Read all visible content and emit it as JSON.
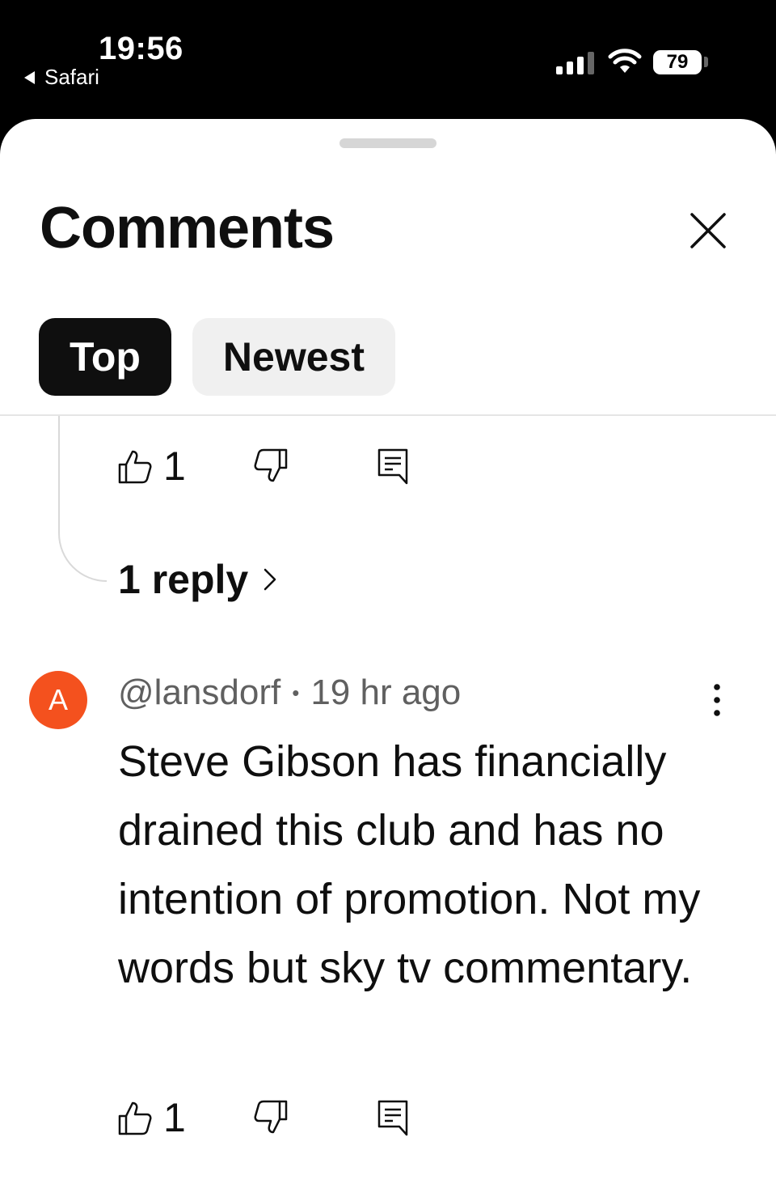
{
  "status_bar": {
    "time": "19:56",
    "back_app": "Safari",
    "battery": "79"
  },
  "sheet": {
    "title": "Comments",
    "tabs": [
      {
        "label": "Top",
        "active": true
      },
      {
        "label": "Newest",
        "active": false
      }
    ]
  },
  "thread_1": {
    "like_count": "1",
    "replies_label": "1 reply"
  },
  "comment_2": {
    "avatar_letter": "A",
    "avatar_color": "#f4511e",
    "author": "@lansdorf",
    "separator": "•",
    "time_ago": "19 hr ago",
    "text": "Steve Gibson has financially drained this club and has no intention of promotion. Not my words but sky tv commentary.",
    "like_count": "1"
  },
  "icons": [
    "thumb-up-icon",
    "thumb-down-icon",
    "reply-icon",
    "close-icon",
    "more-vertical-icon",
    "chevron-right-icon",
    "wifi-icon",
    "signal-icon"
  ]
}
